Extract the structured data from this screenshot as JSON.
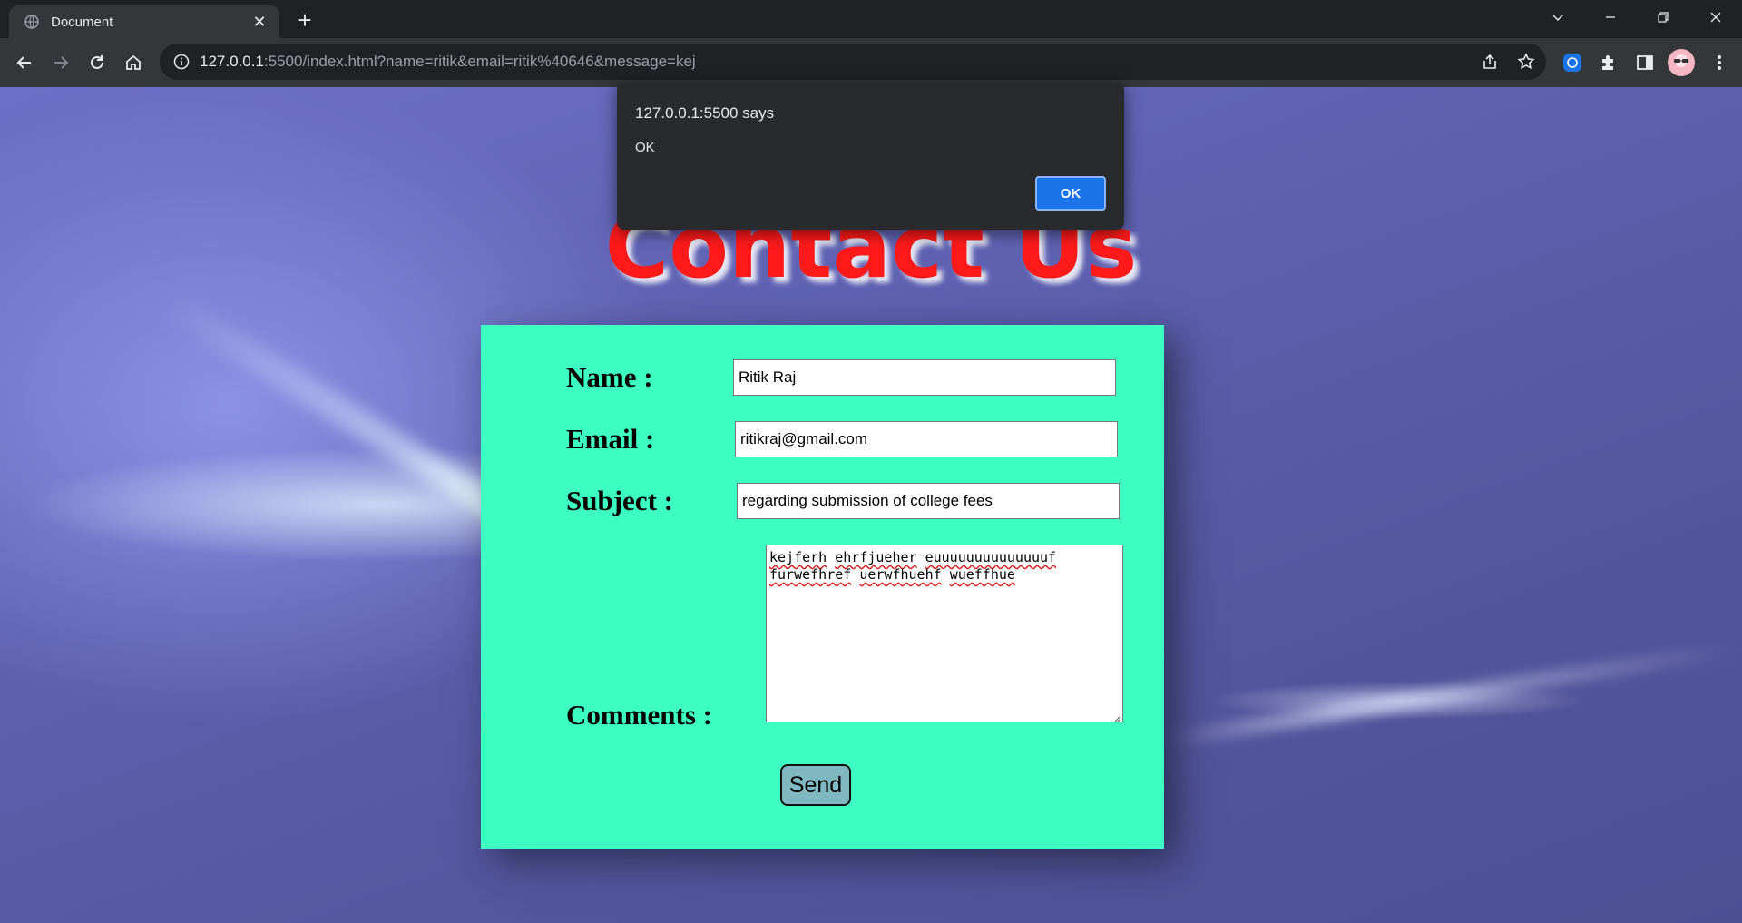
{
  "browser": {
    "tab_title": "Document",
    "url_host": "127.0.0.1",
    "url_rest": ":5500/index.html?name=ritik&email=ritik%40646&message=kej",
    "icons": [
      "globe-icon",
      "close-icon",
      "plus-icon",
      "chevron-down-icon",
      "minimize-icon",
      "restore-icon",
      "window-close-icon",
      "back-icon",
      "forward-icon",
      "reload-icon",
      "home-icon",
      "info-icon",
      "share-icon",
      "star-icon",
      "extension-icon",
      "puzzle-icon",
      "sidepanel-icon",
      "avatar",
      "kebab-menu-icon"
    ]
  },
  "page": {
    "heading": "Contact Us",
    "labels": {
      "name": "Name :",
      "email": "Email :",
      "subject": "Subject :",
      "comments": "Comments :"
    },
    "fields": {
      "name": "Ritik Raj",
      "email": "ritikraj@gmail.com",
      "subject": "regarding submission of college fees",
      "comments_words": [
        "kejferh",
        "ehrfjueher",
        "euuuuuuuuuuuuuuf",
        "furwefhref",
        "uerwfhuehf",
        "wueffhue"
      ]
    },
    "send_label": "Send",
    "colors": {
      "heading": "#ff1a1a",
      "form_background": "#3dffc1",
      "send_button": "#7fb8c0"
    }
  },
  "dialog": {
    "title": "127.0.0.1:5500 says",
    "message": "OK",
    "ok_label": "OK"
  }
}
